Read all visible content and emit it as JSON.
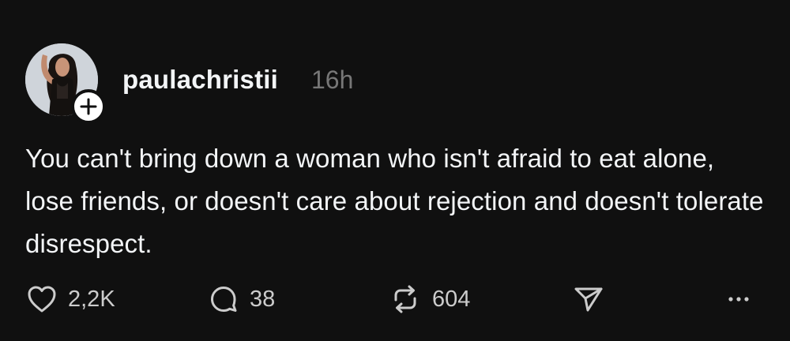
{
  "post": {
    "username": "paulachristii",
    "timestamp": "16h",
    "text": "You can't bring down a woman who isn't afraid to eat alone, lose friends, or doesn't care about rejection and doesn't tolerate disrespect.",
    "follow_icon": "plus-icon",
    "avatar_icon": "avatar"
  },
  "actions": {
    "likes": "2,2K",
    "replies": "38",
    "reposts": "604",
    "like_icon": "heart-icon",
    "reply_icon": "comment-icon",
    "repost_icon": "repost-icon",
    "share_icon": "send-icon",
    "more_icon": "more-icon"
  },
  "colors": {
    "background": "#101010",
    "text": "#f3f5f7",
    "muted": "#777777",
    "icon": "#cccccc"
  }
}
